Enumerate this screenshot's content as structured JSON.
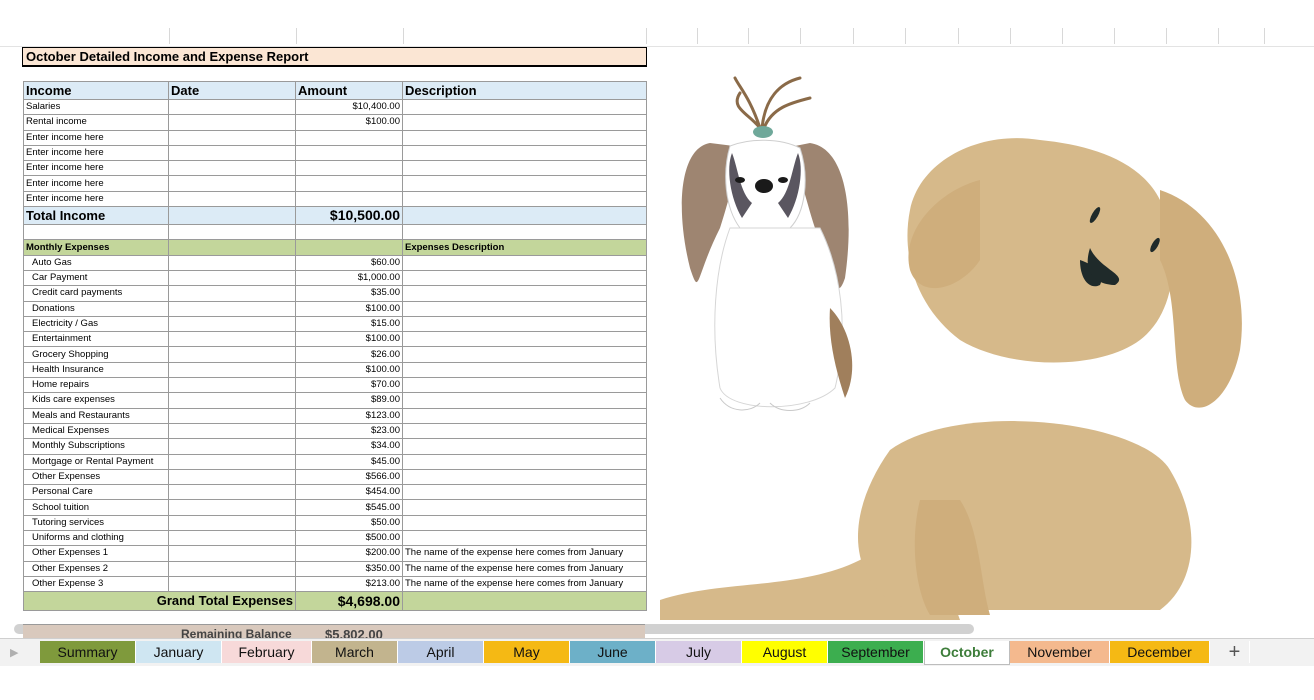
{
  "report": {
    "title": "October Detailed Income and Expense Report"
  },
  "income": {
    "headers": [
      "Income",
      "Date",
      "Amount",
      "Description"
    ],
    "rows": [
      {
        "label": "Salaries",
        "amount": "$10,400.00"
      },
      {
        "label": "Rental income",
        "amount": "$100.00"
      },
      {
        "label": "Enter income here",
        "amount": ""
      },
      {
        "label": "Enter income here",
        "amount": ""
      },
      {
        "label": "Enter income here",
        "amount": ""
      },
      {
        "label": "Enter income here",
        "amount": ""
      },
      {
        "label": "Enter income here",
        "amount": ""
      }
    ],
    "total_label": "Total Income",
    "total_value": "$10,500.00"
  },
  "expenses": {
    "header_label": "Monthly  Expenses",
    "description_header": "Expenses Description",
    "rows": [
      {
        "label": "Auto Gas",
        "amount": "$60.00",
        "desc": ""
      },
      {
        "label": "Car Payment",
        "amount": "$1,000.00",
        "desc": ""
      },
      {
        "label": "Credit card payments",
        "amount": "$35.00",
        "desc": ""
      },
      {
        "label": "Donations",
        "amount": "$100.00",
        "desc": ""
      },
      {
        "label": "Electricity / Gas",
        "amount": "$15.00",
        "desc": ""
      },
      {
        "label": "Entertainment",
        "amount": "$100.00",
        "desc": ""
      },
      {
        "label": "Grocery Shopping",
        "amount": "$26.00",
        "desc": ""
      },
      {
        "label": "Health Insurance",
        "amount": "$100.00",
        "desc": ""
      },
      {
        "label": "Home repairs",
        "amount": "$70.00",
        "desc": ""
      },
      {
        "label": "Kids care expenses",
        "amount": "$89.00",
        "desc": ""
      },
      {
        "label": "Meals and Restaurants",
        "amount": "$123.00",
        "desc": ""
      },
      {
        "label": "Medical Expenses",
        "amount": "$23.00",
        "desc": ""
      },
      {
        "label": "Monthly Subscriptions",
        "amount": "$34.00",
        "desc": ""
      },
      {
        "label": "Mortgage or Rental Payment",
        "amount": "$45.00",
        "desc": ""
      },
      {
        "label": "Other Expenses",
        "amount": "$566.00",
        "desc": ""
      },
      {
        "label": "Personal Care",
        "amount": "$454.00",
        "desc": ""
      },
      {
        "label": "School tuition",
        "amount": "$545.00",
        "desc": ""
      },
      {
        "label": "Tutoring services",
        "amount": "$50.00",
        "desc": ""
      },
      {
        "label": "Uniforms and clothing",
        "amount": "$500.00",
        "desc": ""
      },
      {
        "label": "Other Expenses 1",
        "amount": "$200.00",
        "desc": "The name of the expense here comes from January"
      },
      {
        "label": "Other Expenses  2",
        "amount": "$350.00",
        "desc": "The name of the expense here comes from January"
      },
      {
        "label": "Other Expense 3",
        "amount": "$213.00",
        "desc": "The name of the expense here comes from January"
      }
    ],
    "grand_total_label": "Grand Total Expenses",
    "grand_total_value": "$4,698.00"
  },
  "balance": {
    "label": "Remaining Balance",
    "value": "$5,802.00"
  },
  "illustrations": {
    "left": "shih-tzu-dog-illustration",
    "right": "golden-doodle-dog-illustration"
  },
  "tabs": [
    {
      "label": "Summary",
      "color": "#7f9a3c"
    },
    {
      "label": "January",
      "color": "#cfe6f2"
    },
    {
      "label": "February",
      "color": "#f7d9d9"
    },
    {
      "label": "March",
      "color": "#c2b48e"
    },
    {
      "label": "April",
      "color": "#bccbe6"
    },
    {
      "label": "May",
      "color": "#f5b914"
    },
    {
      "label": "June",
      "color": "#6db0c8"
    },
    {
      "label": "July",
      "color": "#d7cbe6"
    },
    {
      "label": "August",
      "color": "#ffff00"
    },
    {
      "label": "September",
      "color": "#3cae4f"
    },
    {
      "label": "October",
      "color": "#ffffff"
    },
    {
      "label": "November",
      "color": "#f4b98e"
    },
    {
      "label": "December",
      "color": "#f5b914"
    }
  ],
  "active_tab": "October",
  "add_sheet_label": "+"
}
